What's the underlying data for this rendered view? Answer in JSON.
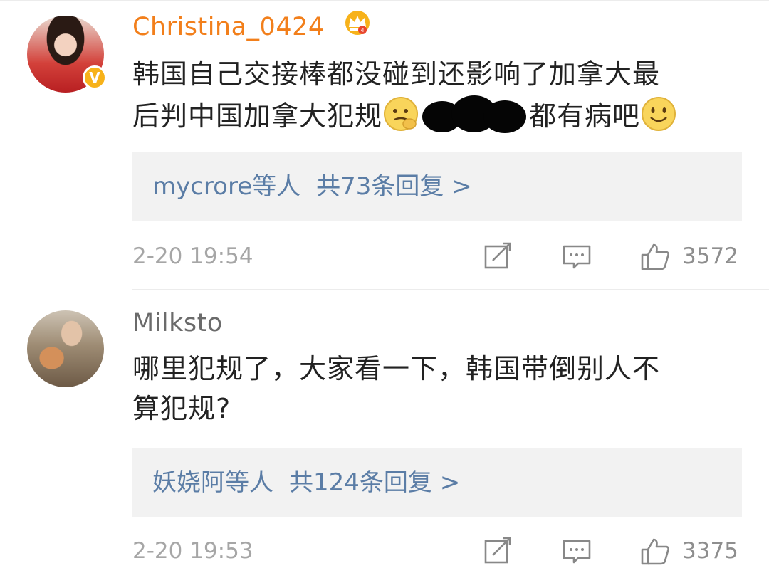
{
  "comments": [
    {
      "username": "Christina_0424",
      "line1": "韩国自己交接棒都没碰到还影响了加拿大最",
      "line2_a": "后判中国加拿大犯规",
      "line2_b": "都有病吧",
      "reply_users": "mycrore等人",
      "reply_count": "共73条回复 >",
      "timestamp": "2-20 19:54",
      "likes": "3572",
      "badge": "V",
      "icons": [
        "avatar",
        "verified-badge-icon",
        "crown-icon",
        "thinking-emoji-icon",
        "redaction-mark",
        "smile-emoji-icon",
        "forward-icon",
        "comment-icon",
        "like-icon"
      ]
    },
    {
      "username": "Milksto",
      "line1": "哪里犯规了，大家看一下，韩国带倒别人不",
      "line2": "算犯规?",
      "reply_users": "妖娆阿等人",
      "reply_count": "共124条回复 >",
      "timestamp": "2-20 19:53",
      "likes": "3375",
      "icons": [
        "avatar",
        "forward-icon",
        "comment-icon",
        "like-icon"
      ]
    }
  ],
  "colors": {
    "vip_username": "#f27f1b",
    "username": "#6b6b6b",
    "link": "#5b7da6",
    "timestamp": "#a6a6a6",
    "reply_bg": "#f2f2f2",
    "badge": "#f7b21a"
  }
}
